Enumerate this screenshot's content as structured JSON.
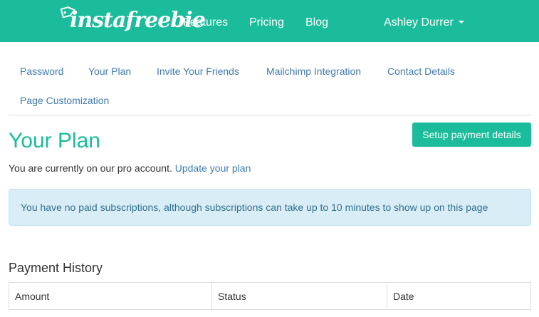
{
  "navbar": {
    "logo_text": "instafreebie",
    "links": [
      "Features",
      "Pricing",
      "Blog"
    ],
    "user_name": "Ashley Durrer",
    "bg_color": "#1abc9c"
  },
  "tabs": [
    "Password",
    "Your Plan",
    "Invite Your Friends",
    "Mailchimp Integration",
    "Contact Details",
    "Page Customization"
  ],
  "main": {
    "title": "Your Plan",
    "setup_button": "Setup payment details",
    "plan_text": "You are currently on our pro account.",
    "update_link": "Update your plan",
    "alert": "You have no paid subscriptions, although subscriptions can take up to 10 minutes to show up on this page"
  },
  "payment_history": {
    "title": "Payment History",
    "columns": [
      "Amount",
      "Status",
      "Date"
    ]
  }
}
